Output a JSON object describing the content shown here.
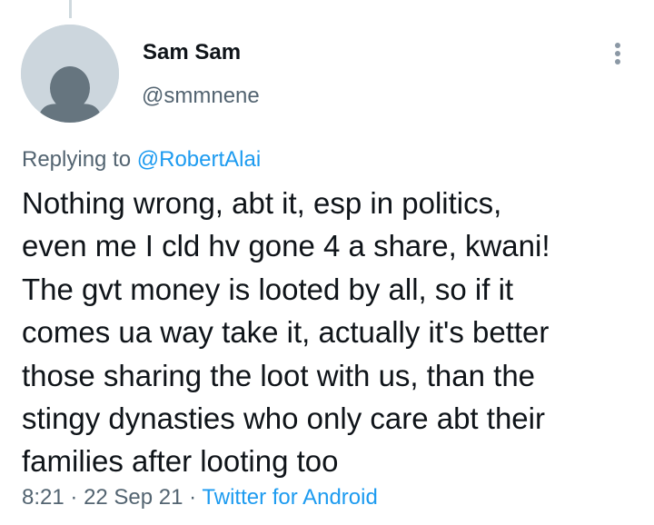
{
  "author": {
    "display_name": "Sam Sam",
    "handle": "@smmnene"
  },
  "reply": {
    "prefix": "Replying to",
    "mention": "@RobertAlai"
  },
  "tweet": {
    "lines": [
      "Nothing wrong, abt it, esp in politics,",
      "even me I cld hv gone 4 a share, kwani!",
      "The gvt money is looted by all, so if it",
      "comes ua way take it, actually it's better",
      "those sharing the loot with us, than the",
      "stingy dynasties who only care abt their",
      "families after looting too"
    ]
  },
  "meta": {
    "time": "8:21",
    "sep1": "·",
    "date": "22 Sep 21",
    "sep2": "·",
    "source": "Twitter for Android"
  },
  "icons": {
    "avatar": "default-avatar-icon",
    "more": "more-dots-vertical-icon"
  },
  "colors": {
    "text": "#0f1419",
    "secondary": "#536471",
    "link": "#1d9bf0",
    "avatar_bg": "#ccd6dd",
    "avatar_fg": "#66757f",
    "thread_line": "#cfd9de"
  }
}
